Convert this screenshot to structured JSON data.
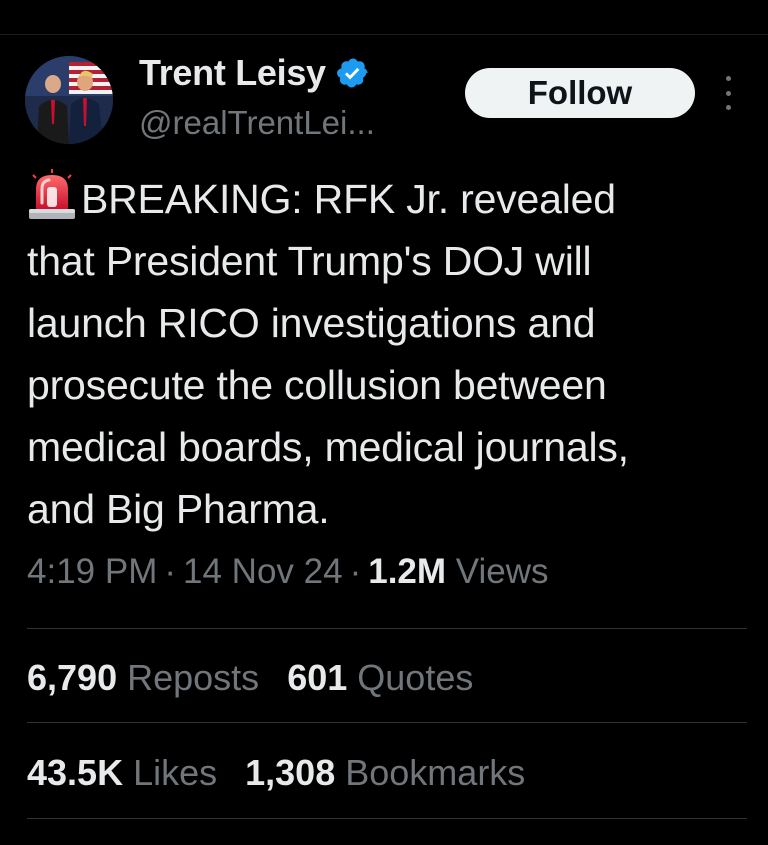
{
  "author": {
    "display_name": "Trent Leisy",
    "handle": "@realTrentLei...",
    "verified_icon": "verified-badge-icon",
    "avatar": "profile-avatar"
  },
  "actions": {
    "follow_label": "Follow",
    "more_icon": "more-options-icon"
  },
  "tweet": {
    "emoji_icon": "police-siren-icon",
    "lines": [
      "BREAKING: RFK Jr. revealed",
      "that President Trump's DOJ will",
      "launch RICO investigations and",
      "prosecute the collusion between",
      "medical boards, medical journals,",
      "and Big Pharma."
    ]
  },
  "meta": {
    "time": "4:19 PM",
    "separator": "·",
    "date": "14 Nov 24",
    "views_count": "1.2M",
    "views_label": "Views"
  },
  "stats": {
    "reposts_count": "6,790",
    "reposts_label": "Reposts",
    "quotes_count": "601",
    "quotes_label": "Quotes",
    "likes_count": "43.5K",
    "likes_label": "Likes",
    "bookmarks_count": "1,308",
    "bookmarks_label": "Bookmarks"
  },
  "colors": {
    "background": "#000000",
    "text_primary": "#e7e9ea",
    "text_secondary": "#71767b",
    "verified_blue": "#1d9bf0",
    "divider": "#2f3336",
    "follow_bg": "#eff3f4"
  }
}
